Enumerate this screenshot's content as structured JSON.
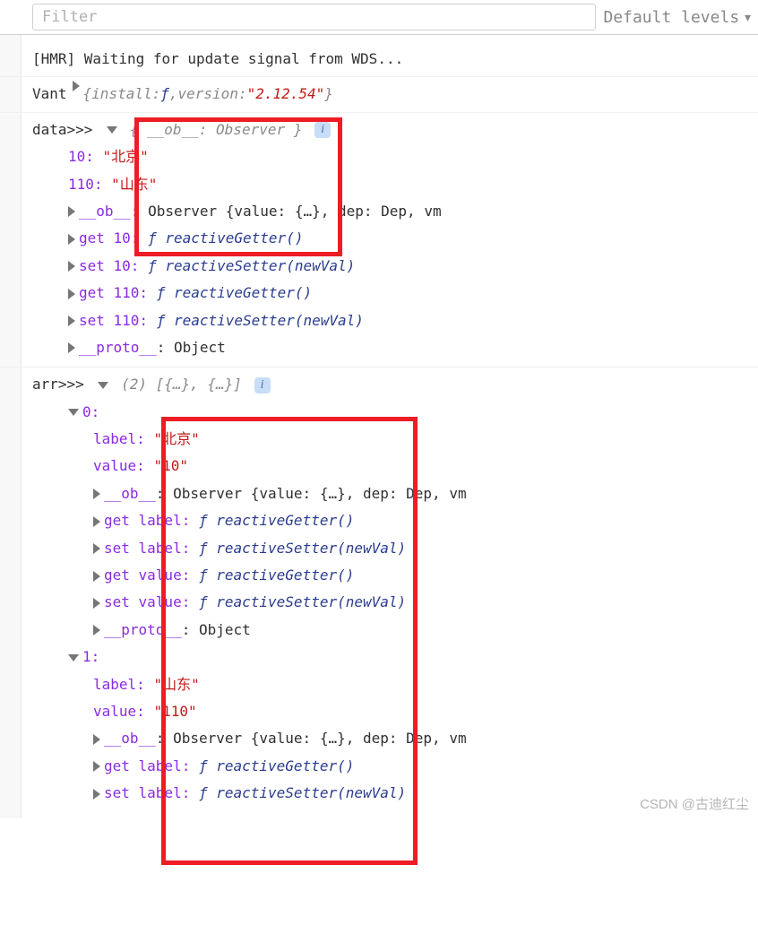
{
  "filter": {
    "placeholder": "Filter"
  },
  "levels": {
    "label": "Default levels"
  },
  "hmr": {
    "msg": "[HMR] Waiting for update signal from WDS..."
  },
  "vant": {
    "label": "Vant ",
    "open": "{",
    "k1": "install: ",
    "f": "ƒ",
    "sep": ", ",
    "k2": "version: ",
    "ver": "\"2.12.54\"",
    "close": "}"
  },
  "data": {
    "label": "data>>> ",
    "head_open": "{",
    "head_k": "__ob__: Observer",
    "head_close": "}",
    "k10": "10: ",
    "v10": "\"北京\"",
    "k110": "110: ",
    "v110": "\"山东\"",
    "ob_k": "__ob__",
    "ob_v": ": Observer {value: {…}, dep: Dep, vm",
    "g10k": "get 10: ",
    "g10v": "ƒ reactiveGetter()",
    "s10k": "set 10: ",
    "s10v": "ƒ reactiveSetter(newVal)",
    "g110k": "get 110: ",
    "g110v": "ƒ reactiveGetter()",
    "s110k": "set 110: ",
    "s110v": "ƒ reactiveSetter(newVal)",
    "protok": "__proto__",
    "protov": ": Object"
  },
  "arr": {
    "label": "arr>>> ",
    "head": "(2) [{…}, {…}]",
    "i0": "0:",
    "i1": "1:",
    "labelk": "label: ",
    "label0": "\"北京\"",
    "label1": "\"山东\"",
    "valuek": "value: ",
    "value0": "\"10\"",
    "value1": "\"110\"",
    "obk": "__ob__",
    "obv": ": Observer {value: {…}, dep: Dep, vm",
    "glabelk": "get label: ",
    "glabelv": "ƒ reactiveGetter()",
    "slabelk": "set label: ",
    "slabelv": "ƒ reactiveSetter(newVal)",
    "gvalk": "get value: ",
    "gvalv": "ƒ reactiveGetter()",
    "svalk": "set value: ",
    "svalv": "ƒ reactiveSetter(newVal)",
    "protok": "__proto__",
    "protov": ": Object"
  },
  "watermark": "CSDN @古迪红尘"
}
